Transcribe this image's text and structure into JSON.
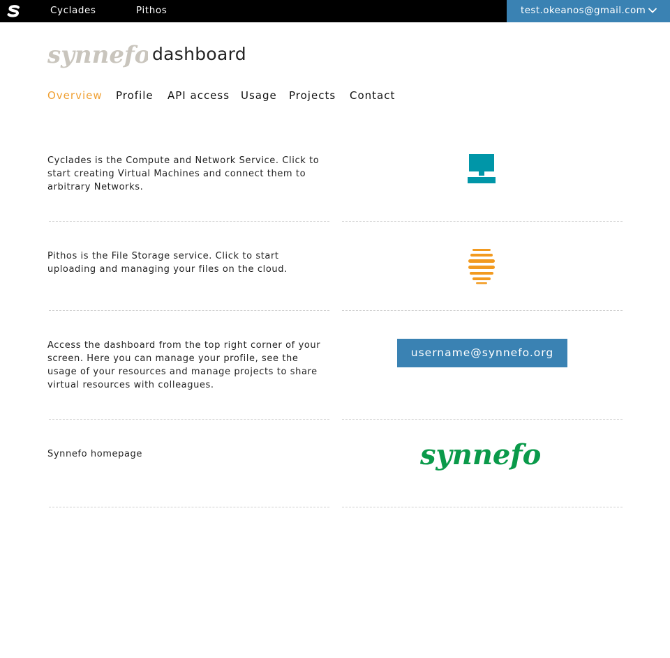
{
  "topbar": {
    "logo_icon": "synnefo-s-icon",
    "services": [
      "Cyclades",
      "Pithos"
    ],
    "user_email": "test.okeanos@gmail.com",
    "user_menu_icon": "chevron-down-icon",
    "background": "#000000",
    "accent": "#3a82b3"
  },
  "header": {
    "brand_wordmark": "synnefo",
    "title": "dashboard"
  },
  "nav": {
    "items": [
      "Overview",
      "Profile",
      "API access",
      "Usage",
      "Projects",
      "Contact"
    ],
    "active": "Overview",
    "active_color": "#f0a033"
  },
  "rows": [
    {
      "text": "Cyclades is the Compute and Network Service. Click to start creating Virtual Machines and connect them to arbitrary Networks.",
      "icon": "cyclades-monitor-icon",
      "icon_color": "#0096a8"
    },
    {
      "text": "Pithos is the File Storage service. Click to start uploading and managing your files on the cloud.",
      "icon": "pithos-storage-icon",
      "icon_color": "#f29a1f"
    },
    {
      "text": "Access the dashboard from the top right corner of your screen. Here you can manage your profile, see the usage of your resources and manage projects to share virtual resources with colleagues.",
      "button_label": "username@synnefo.org"
    },
    {
      "text": "Synnefo homepage",
      "logo_text": "synnefo",
      "logo_color": "#0a9a4a"
    }
  ]
}
